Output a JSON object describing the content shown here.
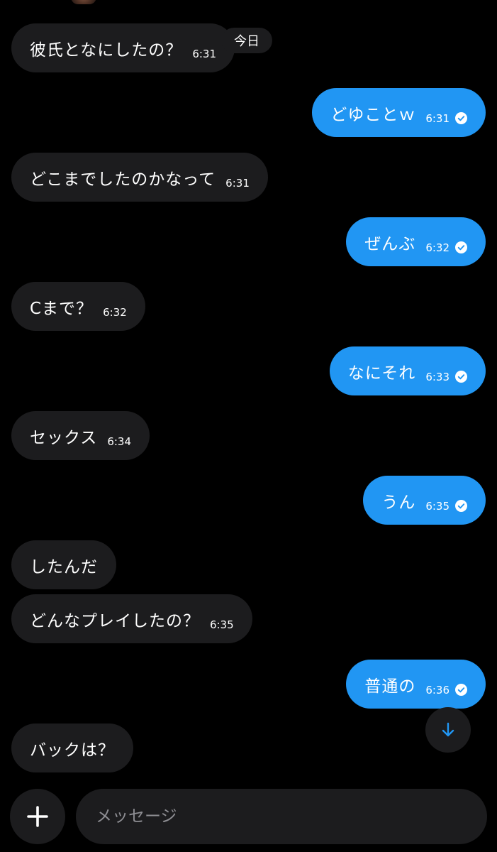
{
  "date_chip": "今日",
  "composer": {
    "placeholder": "メッセージ"
  },
  "colors": {
    "incoming": "#1c1c1e",
    "outgoing": "#2196f3",
    "background": "#000000",
    "scroll_arrow": "#2196f3"
  },
  "messages": [
    {
      "text": "彼氏となにしたの？",
      "time": "6:31"
    },
    {
      "text": "どゆことｗ",
      "time": "6:31"
    },
    {
      "text": "どこまでしたのかなって",
      "time": "6:31"
    },
    {
      "text": "ぜんぶ",
      "time": "6:32"
    },
    {
      "text": "Cまで？",
      "time": "6:32"
    },
    {
      "text": "なにそれ",
      "time": "6:33"
    },
    {
      "text": "セックス",
      "time": "6:34"
    },
    {
      "text": "うん",
      "time": "6:35"
    },
    {
      "text": "したんだ"
    },
    {
      "text": "どんなプレイしたの？",
      "time": "6:35"
    },
    {
      "text": "普通の",
      "time": "6:36"
    },
    {
      "text": "バックは？"
    }
  ]
}
